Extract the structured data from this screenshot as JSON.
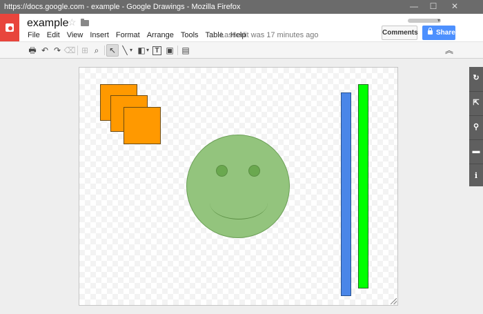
{
  "window": {
    "title": "https://docs.google.com - example - Google Drawings - Mozilla Firefox",
    "minimize": "—",
    "maximize": "☐",
    "close": "✕"
  },
  "header": {
    "doc_title": "example",
    "star": "☆",
    "last_edit": "Last edit was 17 minutes ago",
    "comments_label": "Comments",
    "share_label": "Share"
  },
  "menu": [
    "File",
    "Edit",
    "View",
    "Insert",
    "Format",
    "Arrange",
    "Tools",
    "Table",
    "Help"
  ],
  "toolbar": {
    "print": "🖶",
    "undo": "↶",
    "redo": "↷",
    "paint_format": "⌫",
    "zoom_fit": "⊞",
    "zoom": "⌕",
    "select": "↖",
    "line": "╲",
    "line_caret": "▾",
    "shape": "◧",
    "shape_caret": "▾",
    "textbox": "T",
    "image": "▣",
    "comment": "▤",
    "collapse": "︽"
  },
  "sidepanel": {
    "refresh": "↻",
    "open_new": "⇱",
    "pin": "⚲",
    "layout": "▬",
    "info": "i"
  },
  "colors": {
    "orange_fill": "#ff9900",
    "smiley_fill": "#93c47d",
    "blue_bar": "#4a86e8",
    "green_bar": "#00ff00",
    "share_button": "#4d90fe",
    "logo": "#e8453c"
  }
}
